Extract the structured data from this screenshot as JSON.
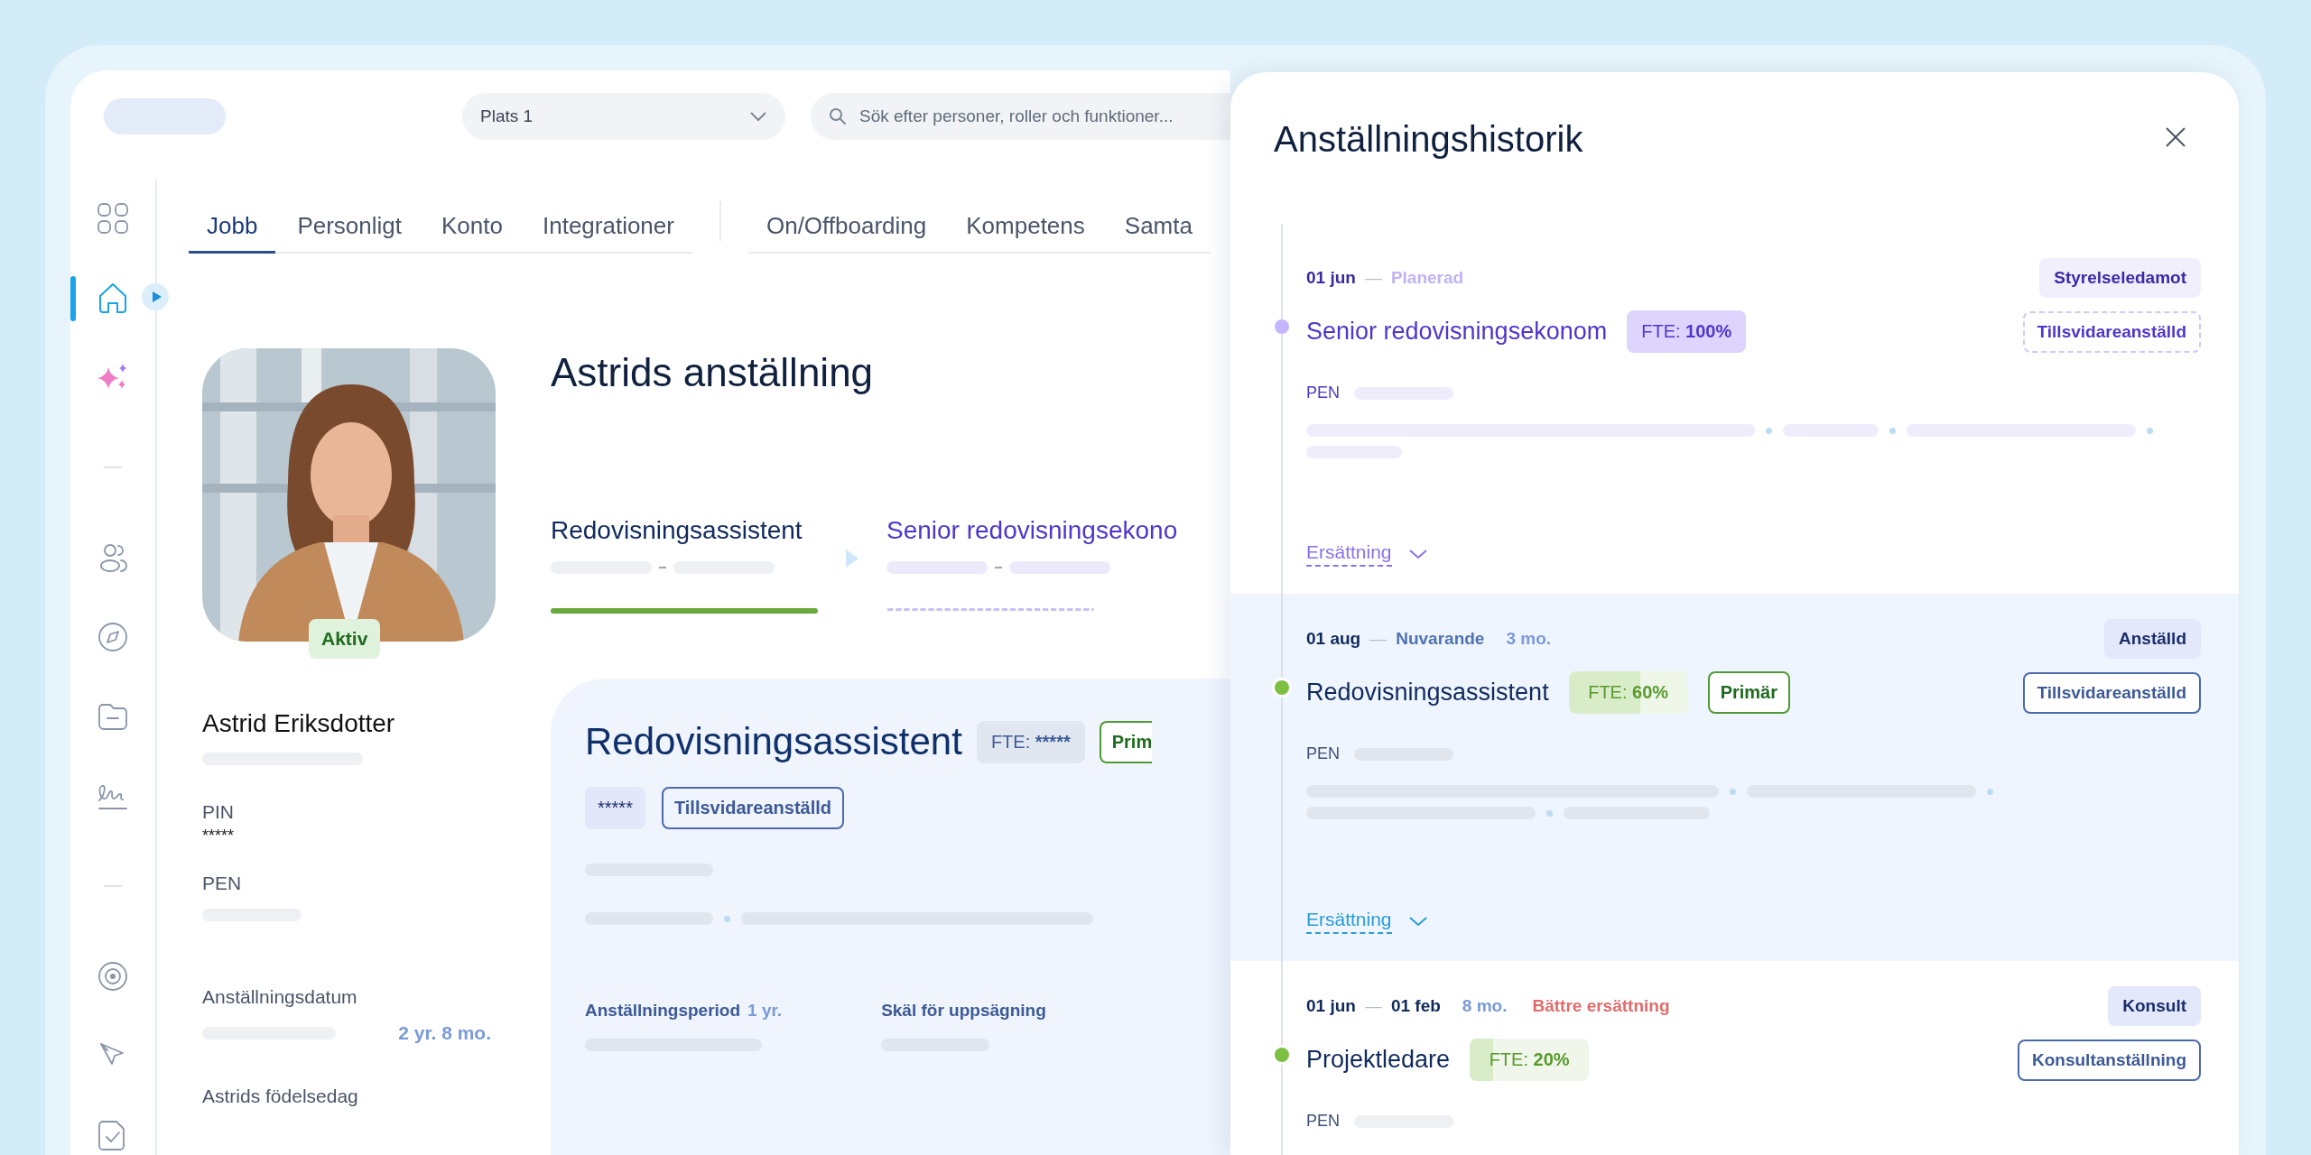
{
  "topbar": {
    "location_select": {
      "value": "Plats 1"
    },
    "search": {
      "placeholder": "Sök efter personer, roller och funktioner..."
    }
  },
  "nav": {
    "groups": [
      [
        {
          "selected": false
        },
        {
          "selected": true
        },
        {
          "selected": false
        }
      ],
      [
        {
          "selected": false
        },
        {
          "selected": false
        },
        {
          "selected": false
        },
        {
          "selected": false
        }
      ],
      [
        {
          "selected": false
        },
        {
          "selected": false
        },
        {
          "selected": false
        }
      ]
    ]
  },
  "tab_groups": [
    [
      {
        "label": "Jobb",
        "selected": true
      },
      {
        "label": "Personligt",
        "selected": false
      },
      {
        "label": "Konto",
        "selected": false
      },
      {
        "label": "Integrationer",
        "selected": false
      }
    ],
    [
      {
        "label": "On/Offboarding",
        "selected": false
      },
      {
        "label": "Kompetens",
        "selected": false
      },
      {
        "label": "Samta",
        "selected": false
      }
    ]
  ],
  "profile": {
    "status": "Aktiv",
    "name": "Astrid Eriksdotter",
    "fields": [
      {
        "label": "PIN",
        "value": "*****"
      },
      {
        "label": "PEN"
      },
      {
        "label": "Anställningsdatum",
        "note": "2 yr. 8 mo."
      },
      {
        "label": "Astrids födelsedag"
      }
    ]
  },
  "employment": {
    "title": "Astrids anställning",
    "steps": [
      {
        "title": "Redovisningsassistent",
        "kind": "current"
      },
      {
        "title": "Senior redovisningsekono",
        "kind": "planned"
      }
    ],
    "card": {
      "title": "Redovisningsassistent",
      "fte": {
        "label": "FTE:",
        "value": "*****"
      },
      "primary": "Prim",
      "tags": [
        {
          "label": "*****",
          "kind": "filled"
        },
        {
          "label": "Tillsvidareanställd",
          "kind": "outlined"
        }
      ],
      "facts": [
        {
          "label": "Anställningsperiod",
          "note": "1 yr."
        },
        {
          "label": "Skäl för uppsägning"
        }
      ]
    }
  },
  "history": {
    "title": "Anställningshistorik",
    "entries": [
      {
        "kind": "planned",
        "start": "01 jun",
        "dash": "—",
        "end": "Planerad",
        "category": "Styrelseledamot",
        "title": "Senior redovisningsekonom",
        "fte": {
          "label": "FTE:",
          "value": "100%",
          "level": 1
        },
        "contract": "Tillsvidareanställd",
        "pen_label": "PEN",
        "link": {
          "label": "Ersättning",
          "expanded": false
        }
      },
      {
        "kind": "current",
        "start": "01 aug",
        "dash": "—",
        "end": "Nuvarande",
        "duration": "3 mo.",
        "category": "Anställd",
        "title": "Redovisningsassistent",
        "fte": {
          "label": "FTE:",
          "value": "60%",
          "level": 0.6
        },
        "primary": "Primär",
        "contract": "Tillsvidareanställd",
        "pen_label": "PEN",
        "link": {
          "label": "Ersättning",
          "expanded": false
        }
      },
      {
        "kind": "past",
        "start": "01 jun",
        "dash": "—",
        "end": "01 feb",
        "duration": "8 mo.",
        "reason": "Bättre ersättning",
        "category": "Konsult",
        "title": "Projektledare",
        "fte": {
          "label": "FTE:",
          "value": "20%",
          "level": 0.2
        },
        "contract": "Konsultanställning",
        "pen_label": "PEN"
      }
    ]
  }
}
